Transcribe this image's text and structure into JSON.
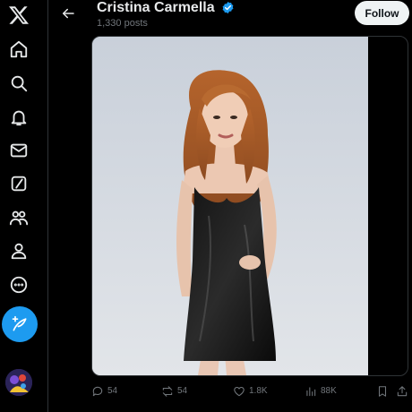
{
  "header": {
    "profile_name": "Cristina Carmella",
    "post_count": "1,330 posts",
    "follow_label": "Follow"
  },
  "nav": {
    "items": [
      "x-logo-icon",
      "home-icon",
      "explore-icon",
      "notifications-icon",
      "messages-icon",
      "grok-icon",
      "communities-icon",
      "profile-icon",
      "more-icon"
    ],
    "compose": "compose-post-icon"
  },
  "actions": {
    "replies": "54",
    "reposts": "54",
    "likes": "1.8K",
    "views": "88K"
  },
  "colors": {
    "background": "#000000",
    "accent": "#1d9bf0",
    "follow_button": "#eff3f4",
    "muted_text": "#71767b"
  }
}
